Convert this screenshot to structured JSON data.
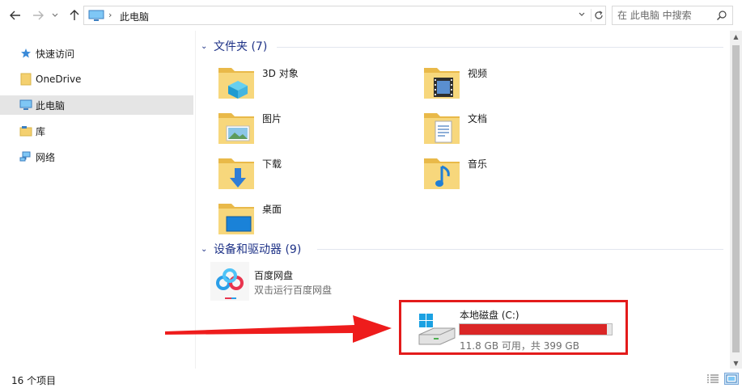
{
  "toolbar": {
    "back_icon": "arrow-left-icon",
    "forward_icon": "arrow-right-icon",
    "recent_icon": "chevron-down-icon",
    "up_icon": "arrow-up-icon",
    "address": {
      "location": "此电脑",
      "icon": "this-pc-icon"
    },
    "search": {
      "placeholder": "在 此电脑 中搜索"
    }
  },
  "sidebar": {
    "items": [
      {
        "label": "快速访问",
        "icon": "star-icon",
        "selected": false
      },
      {
        "label": "OneDrive",
        "icon": "folder-icon",
        "selected": false
      },
      {
        "label": "此电脑",
        "icon": "this-pc-icon",
        "selected": true
      },
      {
        "label": "库",
        "icon": "library-icon",
        "selected": false
      },
      {
        "label": "网络",
        "icon": "network-icon",
        "selected": false
      }
    ]
  },
  "folders_group": {
    "title": "文件夹 (7)",
    "items": [
      {
        "label": "3D 对象",
        "icon": "3d-objects-folder-icon"
      },
      {
        "label": "视频",
        "icon": "videos-folder-icon"
      },
      {
        "label": "图片",
        "icon": "pictures-folder-icon"
      },
      {
        "label": "文档",
        "icon": "documents-folder-icon"
      },
      {
        "label": "下载",
        "icon": "downloads-folder-icon"
      },
      {
        "label": "音乐",
        "icon": "music-folder-icon"
      },
      {
        "label": "桌面",
        "icon": "desktop-folder-icon"
      }
    ]
  },
  "devices_group": {
    "title": "设备和驱动器 (9)",
    "items": [
      {
        "name": "百度网盘",
        "subtitle": "双击运行百度网盘",
        "icon": "baidu-netdisk-icon"
      },
      {
        "name": "本地磁盘 (C:)",
        "free_text": "11.8 GB 可用，共 399 GB",
        "used_fraction": 0.97,
        "icon": "windows-drive-icon"
      }
    ]
  },
  "annotation": {
    "color": "#e31b1b",
    "shape": "arrow-and-box"
  },
  "status_bar": {
    "item_count": "16 个项目"
  },
  "colors": {
    "group_header": "#1e3287",
    "drive_bar": "#da2626",
    "selected_bg": "#e5e5e5"
  }
}
